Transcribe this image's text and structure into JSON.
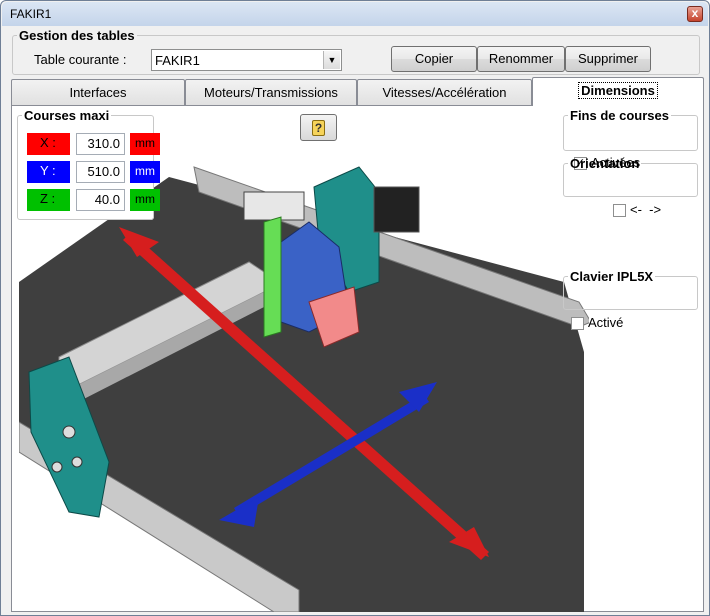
{
  "window": {
    "title": "FAKIR1",
    "close_glyph": "x"
  },
  "table_group": {
    "legend": "Gestion des tables",
    "current_label": "Table courante :",
    "current_value": "FAKIR1",
    "buttons": {
      "copy": "Copier",
      "rename": "Renommer",
      "delete": "Supprimer"
    }
  },
  "tabs": [
    {
      "label": "Interfaces"
    },
    {
      "label": "Moteurs/Transmissions"
    },
    {
      "label": "Vitesses/Accélération"
    },
    {
      "label": "Dimensions"
    }
  ],
  "active_tab": "Dimensions",
  "courses": {
    "legend": "Courses maxi",
    "axes": [
      {
        "label": "X :",
        "value": "310.0",
        "unit": "mm",
        "color": "#ff0000"
      },
      {
        "label": "Y :",
        "value": "510.0",
        "unit": "mm",
        "color": "#0000ff"
      },
      {
        "label": "Z :",
        "value": "40.0",
        "unit": "mm",
        "color": "#00c000"
      }
    ]
  },
  "help_button": {
    "glyph": "?"
  },
  "limits": {
    "legend": "Fins de courses",
    "checkbox_label": "Activées",
    "checked": true
  },
  "orientation": {
    "legend": "Orientation",
    "checkbox_label": "<-  ->",
    "checked": false
  },
  "keyboard": {
    "legend": "Clavier IPL5X",
    "checkbox_label": "Activé",
    "checked": false
  },
  "colors": {
    "accent_titlebar": "#c4d4ea",
    "teal_parts": "#1f8f8a",
    "table_dark": "#3a3a3a"
  },
  "icons": [
    "close-icon",
    "chevron-down-icon",
    "help-icon",
    "checkbox-checked-icon"
  ]
}
